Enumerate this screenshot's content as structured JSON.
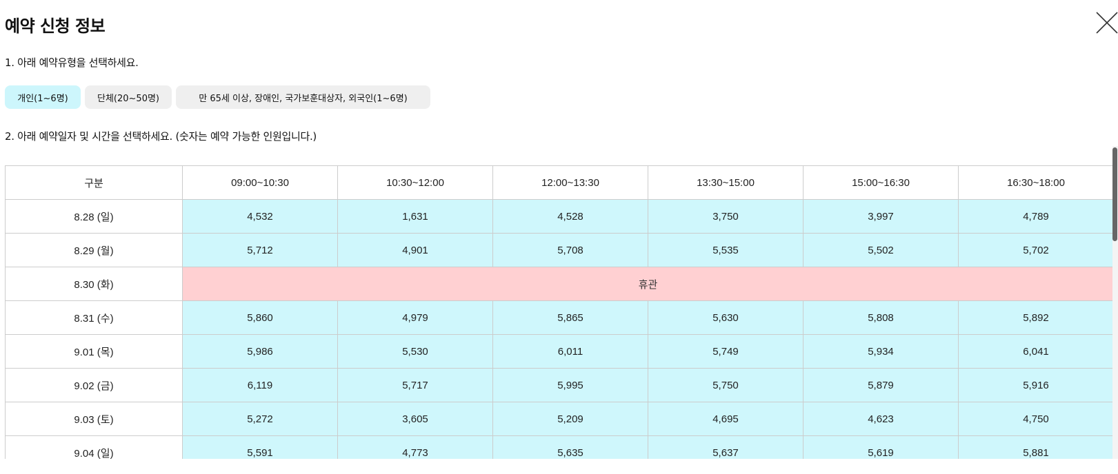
{
  "modal": {
    "title": "예약 신청 정보",
    "step1": "1. 아래 예약유형을 선택하세요.",
    "step2": "2. 아래 예약일자 및 시간을 선택하세요. (숫자는 예약 가능한 인원입니다.)"
  },
  "types": [
    {
      "label": "개인(1~6명)",
      "selected": true
    },
    {
      "label": "단체(20~50명)",
      "selected": false
    },
    {
      "label": "만 65세 이상, 장애인, 국가보훈대상자, 외국인(1~6명)",
      "selected": false
    }
  ],
  "table": {
    "header": {
      "label": "구분",
      "slots": [
        "09:00~10:30",
        "10:30~12:00",
        "12:00~13:30",
        "13:30~15:00",
        "15:00~16:30",
        "16:30~18:00"
      ]
    },
    "rows": [
      {
        "date": "8.28 (일)",
        "values": [
          "4,532",
          "1,631",
          "4,528",
          "3,750",
          "3,997",
          "4,789"
        ]
      },
      {
        "date": "8.29 (월)",
        "values": [
          "5,712",
          "4,901",
          "5,708",
          "5,535",
          "5,502",
          "5,702"
        ]
      },
      {
        "date": "8.30 (화)",
        "closed": "휴관"
      },
      {
        "date": "8.31 (수)",
        "values": [
          "5,860",
          "4,979",
          "5,865",
          "5,630",
          "5,808",
          "5,892"
        ]
      },
      {
        "date": "9.01 (목)",
        "values": [
          "5,986",
          "5,530",
          "6,011",
          "5,749",
          "5,934",
          "6,041"
        ]
      },
      {
        "date": "9.02 (금)",
        "values": [
          "6,119",
          "5,717",
          "5,995",
          "5,750",
          "5,879",
          "5,916"
        ]
      },
      {
        "date": "9.03 (토)",
        "values": [
          "5,272",
          "3,605",
          "5,209",
          "4,695",
          "4,623",
          "4,750"
        ]
      },
      {
        "date": "9.04 (일)",
        "values": [
          "5,591",
          "4,773",
          "5,635",
          "5,637",
          "5,619",
          "5,881"
        ]
      }
    ]
  },
  "colors": {
    "available": "#cff7fc",
    "closed": "#ffd0d2",
    "selected_type": "#cdf6fc"
  }
}
